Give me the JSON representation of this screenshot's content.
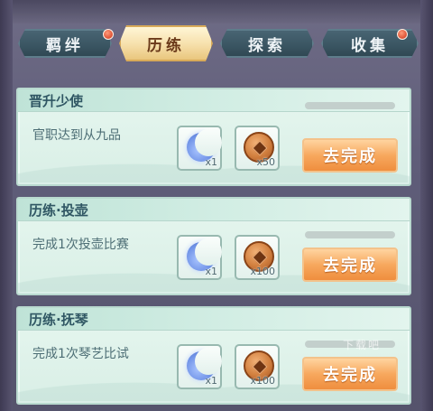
{
  "tabs": [
    {
      "label": "羁绊",
      "active": false,
      "badge": true
    },
    {
      "label": "历练",
      "active": true,
      "badge": false
    },
    {
      "label": "探索",
      "active": false,
      "badge": false
    },
    {
      "label": "收集",
      "active": false,
      "badge": true
    }
  ],
  "tasks": [
    {
      "title": "晋升少使",
      "description": "官职达到从九品",
      "progress": 0,
      "rewards": [
        {
          "icon": "crescent-moon-icon",
          "count": "x1"
        },
        {
          "icon": "copper-coin-icon",
          "count": "x50"
        }
      ],
      "button": "去完成"
    },
    {
      "title": "历练·投壶",
      "description": "完成1次投壶比赛",
      "progress": 0,
      "rewards": [
        {
          "icon": "crescent-moon-icon",
          "count": "x1"
        },
        {
          "icon": "copper-coin-icon",
          "count": "x100"
        }
      ],
      "button": "去完成"
    },
    {
      "title": "历练·抚琴",
      "description": "完成1次琴艺比试",
      "progress": 0,
      "rewards": [
        {
          "icon": "crescent-moon-icon",
          "count": "x1"
        },
        {
          "icon": "copper-coin-icon",
          "count": "x100"
        }
      ],
      "button": "去完成"
    }
  ],
  "watermark": "下载吧"
}
